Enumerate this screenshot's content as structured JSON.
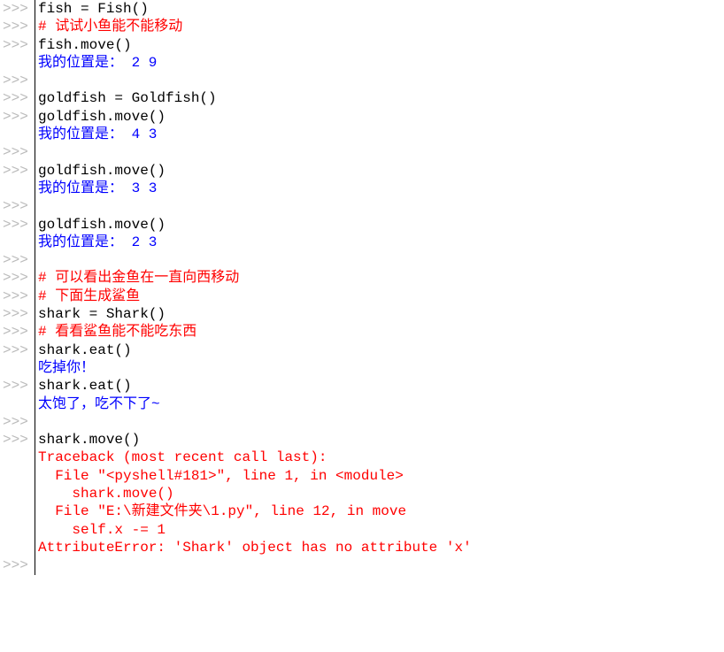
{
  "session": {
    "prompt": ">>>",
    "lines": [
      {
        "g": true,
        "cls": "code-black",
        "txt": "fish = Fish()"
      },
      {
        "g": true,
        "cls": "comment-red",
        "txt": "# 试试小鱼能不能移动"
      },
      {
        "g": true,
        "cls": "code-black",
        "txt": "fish.move()"
      },
      {
        "g": false,
        "cls": "output-blue",
        "txt": "我的位置是： 2 9"
      },
      {
        "g": true,
        "cls": "code-black",
        "txt": ""
      },
      {
        "g": true,
        "cls": "code-black",
        "txt": "goldfish = Goldfish()"
      },
      {
        "g": true,
        "cls": "code-black",
        "txt": "goldfish.move()"
      },
      {
        "g": false,
        "cls": "output-blue",
        "txt": "我的位置是： 4 3"
      },
      {
        "g": true,
        "cls": "code-black",
        "txt": ""
      },
      {
        "g": true,
        "cls": "code-black",
        "txt": "goldfish.move()"
      },
      {
        "g": false,
        "cls": "output-blue",
        "txt": "我的位置是： 3 3"
      },
      {
        "g": true,
        "cls": "code-black",
        "txt": ""
      },
      {
        "g": true,
        "cls": "code-black",
        "txt": "goldfish.move()"
      },
      {
        "g": false,
        "cls": "output-blue",
        "txt": "我的位置是： 2 3"
      },
      {
        "g": true,
        "cls": "code-black",
        "txt": ""
      },
      {
        "g": true,
        "cls": "comment-red",
        "txt": "# 可以看出金鱼在一直向西移动"
      },
      {
        "g": true,
        "cls": "comment-red",
        "txt": "# 下面生成鲨鱼"
      },
      {
        "g": true,
        "cls": "code-black",
        "txt": "shark = Shark()"
      },
      {
        "g": true,
        "cls": "comment-red",
        "txt": "# 看看鲨鱼能不能吃东西"
      },
      {
        "g": true,
        "cls": "code-black",
        "txt": "shark.eat()"
      },
      {
        "g": false,
        "cls": "output-blue",
        "txt": "吃掉你！"
      },
      {
        "g": true,
        "cls": "code-black",
        "txt": "shark.eat()"
      },
      {
        "g": false,
        "cls": "output-blue",
        "txt": "太饱了，吃不下了~"
      },
      {
        "g": true,
        "cls": "code-black",
        "txt": ""
      },
      {
        "g": true,
        "cls": "code-black",
        "txt": "shark.move()"
      },
      {
        "g": false,
        "cls": "error-red",
        "txt": "Traceback (most recent call last):"
      },
      {
        "g": false,
        "cls": "error-red",
        "txt": "  File \"<pyshell#181>\", line 1, in <module>"
      },
      {
        "g": false,
        "cls": "error-red",
        "txt": "    shark.move()"
      },
      {
        "g": false,
        "cls": "error-red",
        "txt": "  File \"E:\\新建文件夹\\1.py\", line 12, in move"
      },
      {
        "g": false,
        "cls": "error-red",
        "txt": "    self.x -= 1"
      },
      {
        "g": false,
        "cls": "error-red",
        "txt": "AttributeError: 'Shark' object has no attribute 'x'"
      },
      {
        "g": true,
        "cls": "code-black",
        "txt": ""
      }
    ]
  }
}
